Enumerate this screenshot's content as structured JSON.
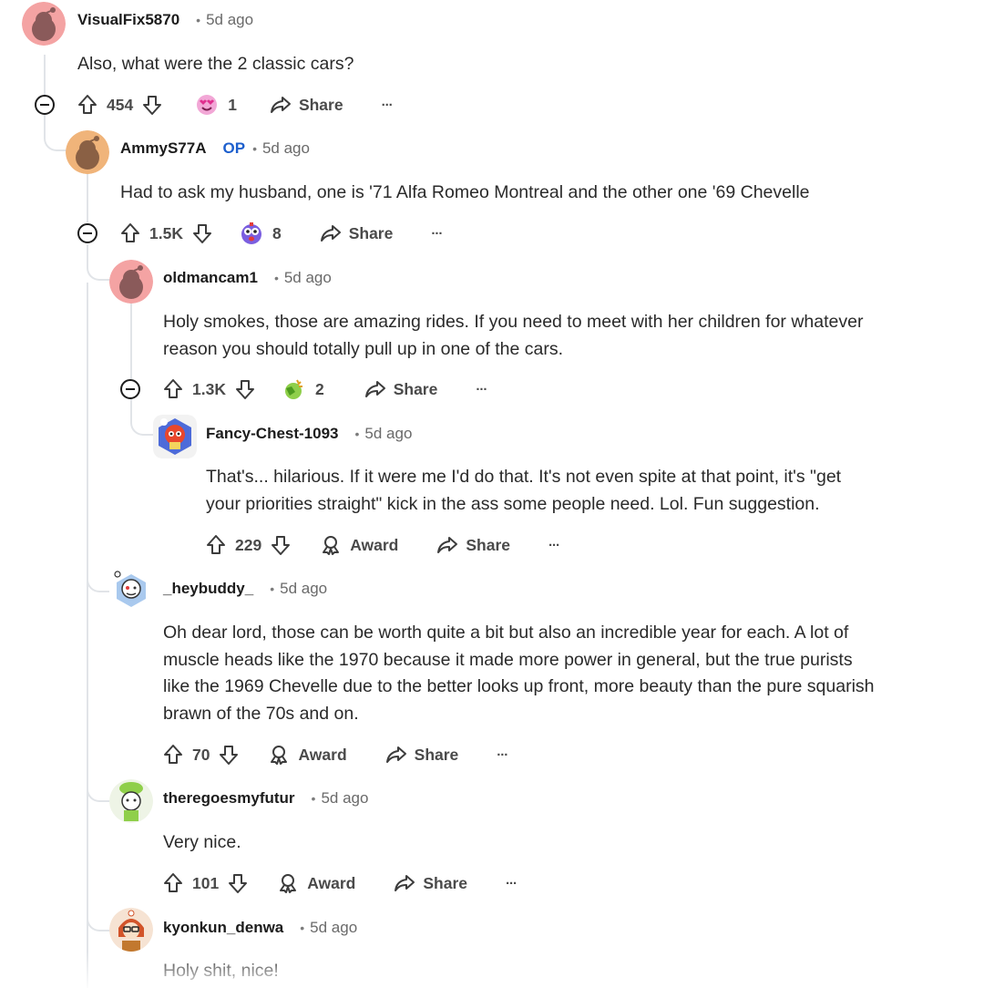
{
  "comments": [
    {
      "username": "VisualFix5870",
      "op": "",
      "time": "5d ago",
      "body": [
        "Also, what were the 2 classic cars?"
      ],
      "votes": "454",
      "award_count": "1",
      "second_action": "award-emoji",
      "share": "Share",
      "more": "···"
    },
    {
      "username": "AmmyS77A",
      "op": "OP",
      "time": "5d ago",
      "body": [
        "Had to ask my husband, one is '71 Alfa Romeo Montreal and the other one '69 Chevelle"
      ],
      "votes": "1.5K",
      "award_count": "8",
      "second_action": "award-emoji",
      "share": "Share",
      "more": "···"
    },
    {
      "username": "oldmancam1",
      "op": "",
      "time": "5d ago",
      "body": [
        "Holy smokes, those are amazing rides. If you need to meet with her children for whatever",
        "reason you should totally pull up in one of the cars."
      ],
      "votes": "1.3K",
      "award_count": "2",
      "second_action": "award-emoji",
      "share": "Share",
      "more": "···"
    },
    {
      "username": "Fancy-Chest-1093",
      "op": "",
      "time": "5d ago",
      "body": [
        "That's... hilarious. If it were me I'd do that. It's not even spite at that point, it's \"get",
        "your priorities straight\" kick in the ass some people need. Lol. Fun suggestion."
      ],
      "votes": "229",
      "award_label": "Award",
      "share": "Share",
      "more": "···"
    },
    {
      "username": "_heybuddy_",
      "op": "",
      "time": "5d ago",
      "body": [
        "Oh dear lord, those can be worth quite a bit but also an incredible year for each. A lot of",
        "muscle heads like the 1970 because it made more power in general, but the true purists",
        "like the 1969 Chevelle due to the better looks up front, more beauty than the pure squarish",
        "brawn of the 70s and on."
      ],
      "votes": "70",
      "award_label": "Award",
      "share": "Share",
      "more": "···"
    },
    {
      "username": "theregoesmyfutur",
      "op": "",
      "time": "5d ago",
      "body": [
        "Very nice."
      ],
      "votes": "101",
      "award_label": "Award",
      "share": "Share",
      "more": "···"
    },
    {
      "username": "kyonkun_denwa",
      "op": "",
      "time": "5d ago",
      "body": [
        "Holy shit, nice!"
      ]
    }
  ],
  "colors": {
    "thread_line": "#e1e4e8",
    "op_badge": "#1d5fcd",
    "text": "#1a1a1b",
    "muted": "#6a6a6a"
  },
  "icons": [
    "upvote-icon",
    "downvote-icon",
    "share-icon",
    "award-icon",
    "more-icon",
    "collapse-icon",
    "avatar-icon"
  ]
}
